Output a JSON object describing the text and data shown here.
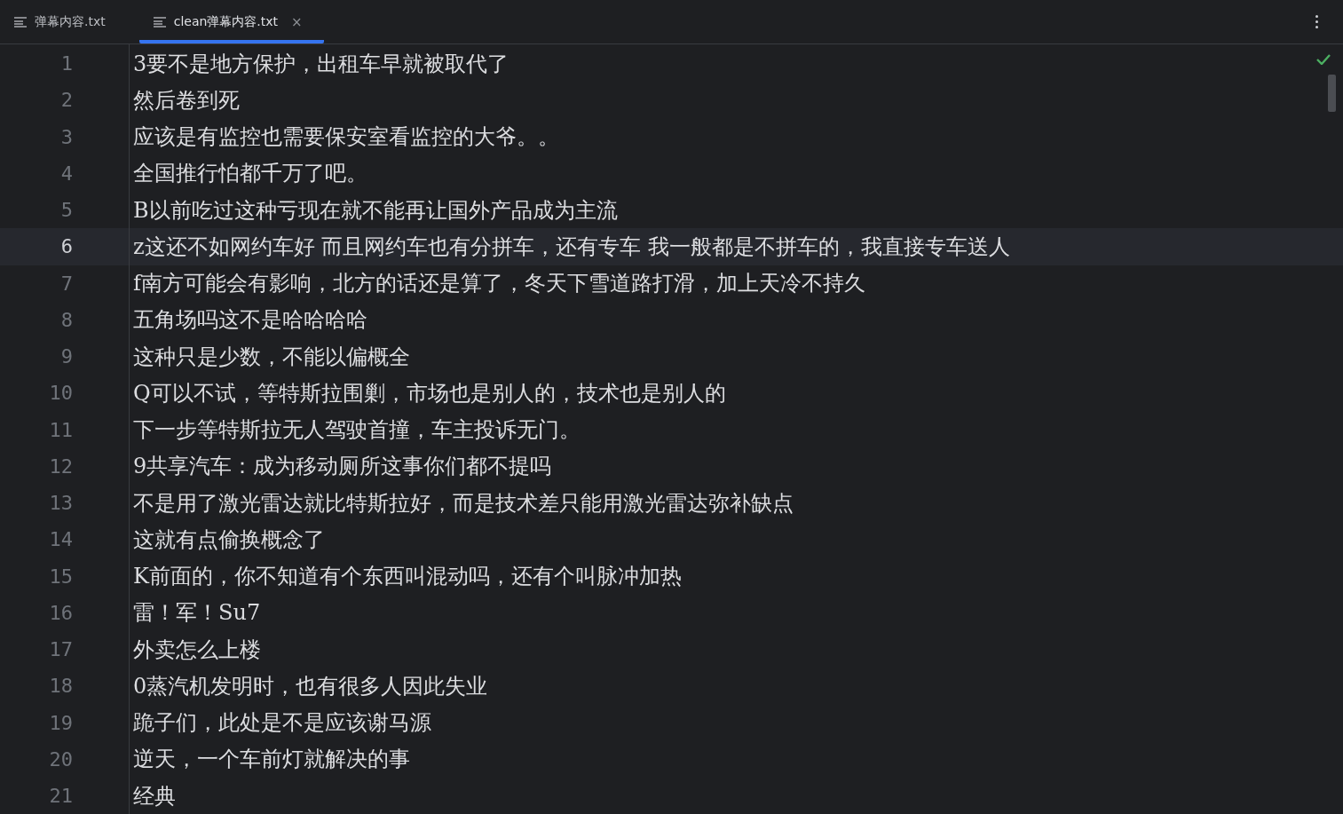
{
  "tabs": [
    {
      "label": "弹幕内容.txt",
      "selected": false,
      "closable": false
    },
    {
      "label": "clean弹幕内容.txt",
      "selected": true,
      "closable": true,
      "close": "×"
    }
  ],
  "editor": {
    "status_ok": true,
    "lines": [
      {
        "number": "1",
        "text": "3要不是地方保护，出租车早就被取代了",
        "current": false
      },
      {
        "number": "2",
        "text": "然后卷到死",
        "current": false
      },
      {
        "number": "3",
        "text": "应该是有监控也需要保安室看监控的大爷。。",
        "current": false
      },
      {
        "number": "4",
        "text": "全国推行怕都千万了吧。",
        "current": false
      },
      {
        "number": "5",
        "text": "B以前吃过这种亏现在就不能再让国外产品成为主流",
        "current": false
      },
      {
        "number": "6",
        "text": "z这还不如网约车好  而且网约车也有分拼车，还有专车  我一般都是不拼车的，我直接专车送人",
        "current": true
      },
      {
        "number": "7",
        "text": "f南方可能会有影响，北方的话还是算了，冬天下雪道路打滑，加上天冷不持久",
        "current": false
      },
      {
        "number": "8",
        "text": "五角场吗这不是哈哈哈哈",
        "current": false
      },
      {
        "number": "9",
        "text": "这种只是少数，不能以偏概全",
        "current": false
      },
      {
        "number": "10",
        "text": "Q可以不试，等特斯拉围剿，市场也是别人的，技术也是别人的",
        "current": false
      },
      {
        "number": "11",
        "text": "下一步等特斯拉无人驾驶首撞，车主投诉无门。",
        "current": false
      },
      {
        "number": "12",
        "text": "9共享汽车：成为移动厕所这事你们都不提吗",
        "current": false
      },
      {
        "number": "13",
        "text": "不是用了激光雷达就比特斯拉好，而是技术差只能用激光雷达弥补缺点",
        "current": false
      },
      {
        "number": "14",
        "text": "这就有点偷换概念了",
        "current": false
      },
      {
        "number": "15",
        "text": "K前面的，你不知道有个东西叫混动吗，还有个叫脉冲加热",
        "current": false
      },
      {
        "number": "16",
        "text": "雷！军！Su7",
        "current": false
      },
      {
        "number": "17",
        "text": "外卖怎么上楼",
        "current": false
      },
      {
        "number": "18",
        "text": "0蒸汽机发明时，也有很多人因此失业",
        "current": false
      },
      {
        "number": "19",
        "text": "跪子们，此处是不是应该谢马源",
        "current": false
      },
      {
        "number": "20",
        "text": "逆天，一个车前灯就解决的事",
        "current": false
      },
      {
        "number": "21",
        "text": "经典",
        "current": false
      }
    ]
  }
}
